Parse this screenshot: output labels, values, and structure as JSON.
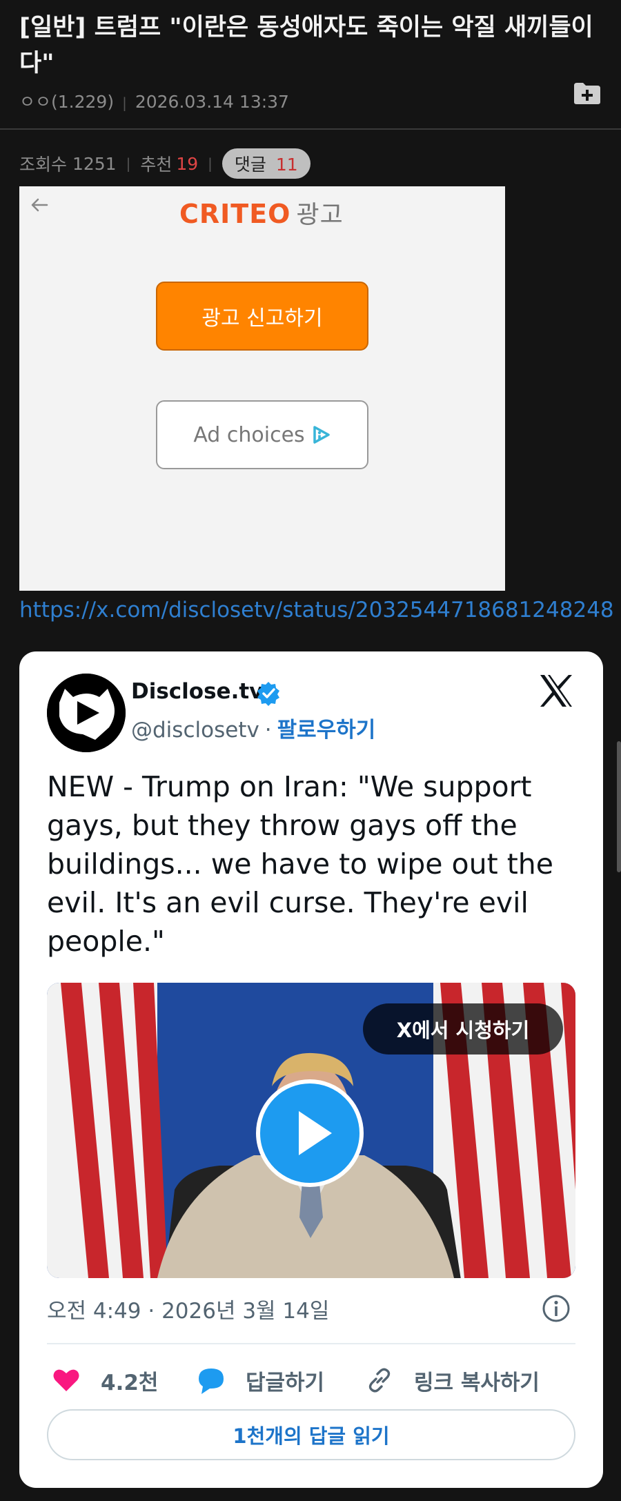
{
  "post": {
    "title": "[일반] 트럼프 \"이란은 동성애자도 죽이는 악질 새끼들이다\"",
    "author": "ㅇㅇ(1.229)",
    "date": "2026.03.14 13:37",
    "folder_icon": "folder-plus-icon"
  },
  "stats": {
    "views_label": "조회수",
    "views": "1251",
    "recommend_label": "추천",
    "recommend": "19",
    "comments_label": "댓글",
    "comments": "11"
  },
  "ad": {
    "brand": "CRITEO",
    "brand_suffix": "광고",
    "report_label": "광고 신고하기",
    "choices_label": "Ad choices",
    "back_icon": "arrow-left-icon",
    "brand_color": "#f05a22",
    "report_color": "#ff8400"
  },
  "tweet_link": "https://x.com/disclosetv/status/2032544718681248248",
  "tweet": {
    "author_name": "Disclose.tv",
    "handle": "@disclosetv",
    "separator": "·",
    "follow_label": "팔로우하기",
    "text": "NEW - Trump on Iran: \"We support gays, but they throw gays off the buildings... we have to wipe out the evil. It's an evil curse. They're evil people.\"",
    "watch_label": "X에서 시청하기",
    "timestamp": "오전 4:49 · 2026년 3월 14일",
    "likes": "4.2천",
    "reply_label": "답글하기",
    "copy_link_label": "링크 복사하기",
    "read_replies_label": "1천개의 답글 읽기",
    "accent_color": "#1d9bf0",
    "like_color": "#f91880"
  }
}
